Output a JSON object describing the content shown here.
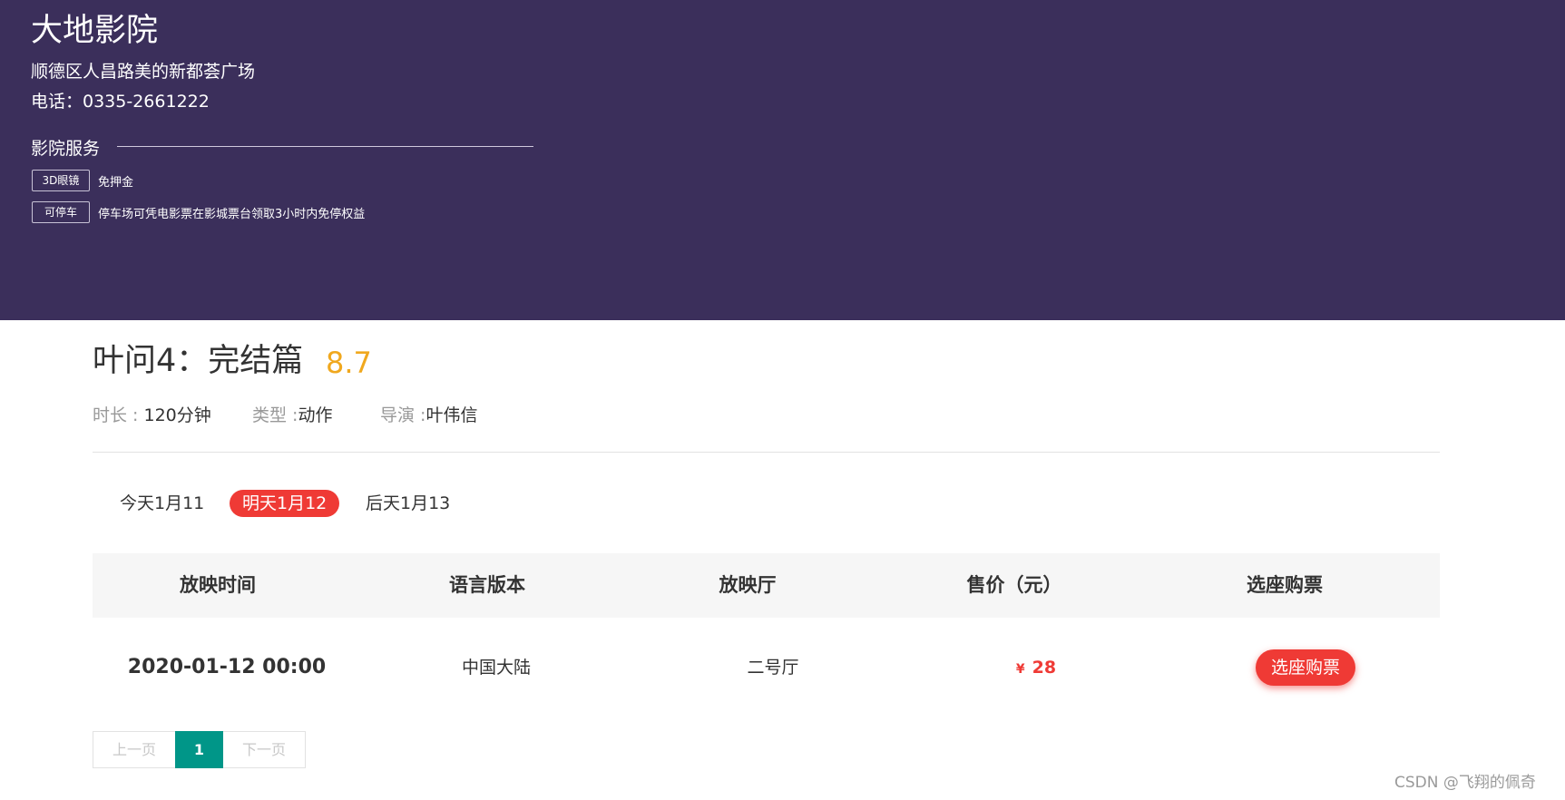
{
  "cinema": {
    "name": "大地影院",
    "address": "顺德区人昌路美的新都荟广场",
    "phone": "电话：0335-2661222",
    "services_title": "影院服务",
    "services": [
      {
        "tag": "3D眼镜",
        "desc": "免押金"
      },
      {
        "tag": "可停车",
        "desc": "停车场可凭电影票在影城票台领取3小时内免停权益"
      }
    ]
  },
  "movie": {
    "title": "叶问4：完结篇",
    "score": "8.7",
    "duration_label": "时长 : ",
    "duration_value": "120分钟",
    "genre_label": "类型 :",
    "genre_value": "动作",
    "director_label": "导演 :",
    "director_value": "叶伟信"
  },
  "date_tabs": [
    {
      "label": "今天1月11",
      "active": false
    },
    {
      "label": "明天1月12",
      "active": true
    },
    {
      "label": "后天1月13",
      "active": false
    }
  ],
  "table": {
    "headers": [
      "放映时间",
      "语言版本",
      "放映厅",
      "售价（元）",
      "选座购票"
    ],
    "rows": [
      {
        "time": "2020-01-12 00:00",
        "language": "中国大陆",
        "hall": "二号厅",
        "currency": "¥",
        "price": "28",
        "action": "选座购票"
      }
    ]
  },
  "pagination": {
    "prev": "上一页",
    "current": "1",
    "next": "下一页"
  },
  "watermark": "CSDN @飞翔的佩奇",
  "colors": {
    "banner": "#3b2f5b",
    "accent_red": "#ef3a35",
    "score": "#f0a81e",
    "pager_active": "#009688"
  }
}
